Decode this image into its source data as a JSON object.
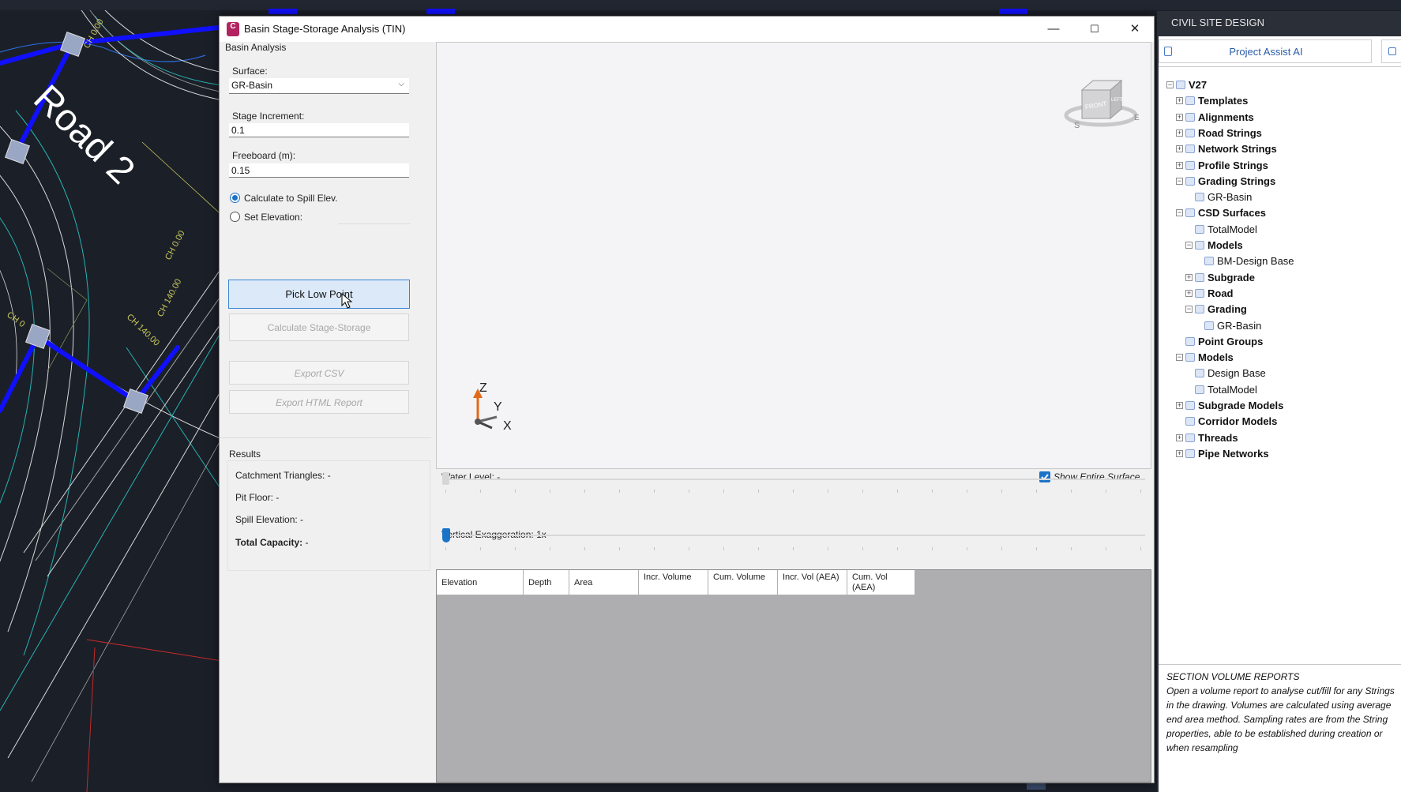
{
  "dialog": {
    "title": "Basin Stage-Storage Analysis (TIN)",
    "app_icon_letter": "C",
    "window_controls": {
      "minimize": "—",
      "maximize": "☐",
      "close": "✕"
    }
  },
  "left": {
    "group_title": "Basin Analysis",
    "surface_label": "Surface:",
    "surface_value": "GR-Basin",
    "stage_increment_label": "Stage Increment:",
    "stage_increment_value": "0.1",
    "freeboard_label": "Freeboard (m):",
    "freeboard_value": "0.15",
    "radio_spill_label": "Calculate to Spill Elev.",
    "radio_set_label": "Set Elevation:",
    "radio_selected": "spill",
    "pick_low_point": "Pick Low Point",
    "calc_stage_storage": "Calculate Stage-Storage",
    "export_csv": "Export CSV",
    "export_html": "Export HTML Report"
  },
  "results": {
    "title": "Results",
    "catchment": "Catchment Triangles: -",
    "pit_floor": "Pit Floor: -",
    "spill_elev": "Spill Elevation: -",
    "total_capacity_label": "Total Capacity:",
    "total_capacity_value": "-"
  },
  "viewport": {
    "axis_z": "Z",
    "axis_y": "Y",
    "axis_x": "X",
    "viewcube_face": "FRONT",
    "viewcube_side": "LEFT",
    "compass_s": "S",
    "compass_e": "E"
  },
  "controls": {
    "water_level": "Water Level: -",
    "show_entire_surface": "Show Entire Surface",
    "show_entire_checked": true,
    "vertical_exaggeration": "Vertical Exaggeration: 1x",
    "water_level_fraction": 0,
    "exaggeration_fraction": 0
  },
  "table": {
    "columns": [
      "Elevation",
      "Depth",
      "Area",
      "Incr. Volume",
      "Cum. Volume",
      "Incr. Vol (AEA)",
      "Cum. Vol (AEA)"
    ]
  },
  "cad": {
    "road_label": "Road 2",
    "ch_labels": [
      "CH 0.00",
      "CH 0.00",
      "CH 140.00",
      "CH 140.00",
      "CH 0"
    ]
  },
  "right_panel": {
    "title": "CIVIL SITE DESIGN",
    "ai_button": "Project Assist AI",
    "tree": [
      {
        "label": "V27",
        "level": 0,
        "bold": true,
        "exp": "-"
      },
      {
        "label": "Templates",
        "level": 1,
        "bold": true,
        "exp": "+"
      },
      {
        "label": "Alignments",
        "level": 1,
        "bold": true,
        "exp": "+"
      },
      {
        "label": "Road Strings",
        "level": 1,
        "bold": true,
        "exp": "+"
      },
      {
        "label": "Network Strings",
        "level": 1,
        "bold": true,
        "exp": "+"
      },
      {
        "label": "Profile Strings",
        "level": 1,
        "bold": true,
        "exp": "+"
      },
      {
        "label": "Grading Strings",
        "level": 1,
        "bold": true,
        "exp": "-"
      },
      {
        "label": "GR-Basin",
        "level": 2,
        "bold": false,
        "exp": ""
      },
      {
        "label": "CSD Surfaces",
        "level": 1,
        "bold": true,
        "exp": "-"
      },
      {
        "label": "TotalModel",
        "level": 2,
        "bold": false,
        "exp": ""
      },
      {
        "label": "Models",
        "level": 2,
        "bold": true,
        "exp": "-"
      },
      {
        "label": "BM-Design Base",
        "level": 3,
        "bold": false,
        "exp": ""
      },
      {
        "label": "Subgrade",
        "level": 2,
        "bold": true,
        "exp": "+"
      },
      {
        "label": "Road",
        "level": 2,
        "bold": true,
        "exp": "+"
      },
      {
        "label": "Grading",
        "level": 2,
        "bold": true,
        "exp": "-"
      },
      {
        "label": "GR-Basin",
        "level": 3,
        "bold": false,
        "exp": ""
      },
      {
        "label": "Point Groups",
        "level": 1,
        "bold": true,
        "exp": ""
      },
      {
        "label": "Models",
        "level": 1,
        "bold": true,
        "exp": "-"
      },
      {
        "label": "Design Base",
        "level": 2,
        "bold": false,
        "exp": ""
      },
      {
        "label": "TotalModel",
        "level": 2,
        "bold": false,
        "exp": ""
      },
      {
        "label": "Subgrade Models",
        "level": 1,
        "bold": true,
        "exp": "+"
      },
      {
        "label": "Corridor Models",
        "level": 1,
        "bold": true,
        "exp": ""
      },
      {
        "label": "Threads",
        "level": 1,
        "bold": true,
        "exp": "+"
      },
      {
        "label": "Pipe Networks",
        "level": 1,
        "bold": true,
        "exp": "+"
      }
    ],
    "description_title": "SECTION VOLUME REPORTS",
    "description_body": "Open a volume report to analyse cut/fill for any Strings in the drawing.  Volumes are calculated using average end area method. Sampling rates are from the String properties, able to be established during creation or when resampling"
  },
  "colors": {
    "cad_bg": "#1b1f28",
    "road_blue": "#1010ff",
    "accent_blue": "#1a73c7",
    "grid_gray": "#aeadaf"
  }
}
